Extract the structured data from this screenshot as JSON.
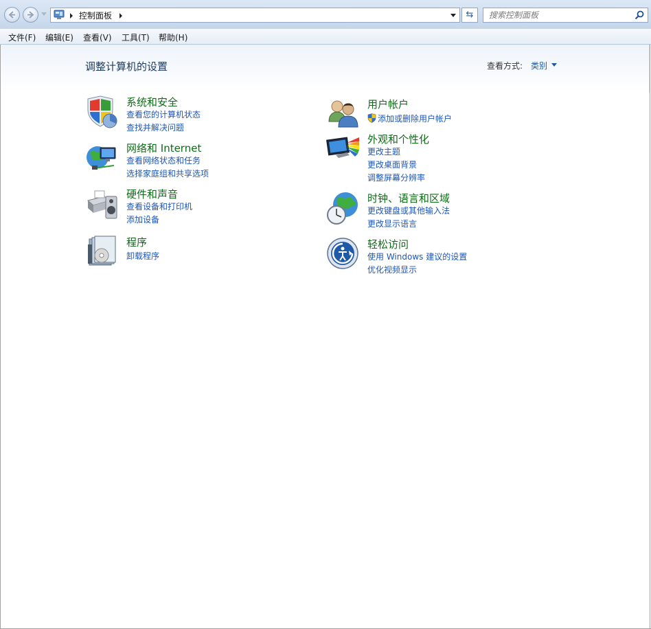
{
  "address_bar": {
    "breadcrumb": "控制面板",
    "search_placeholder": "搜索控制面板"
  },
  "menu": [
    "文件(F)",
    "编辑(E)",
    "查看(V)",
    "工具(T)",
    "帮助(H)"
  ],
  "page_title": "调整计算机的设置",
  "view_by": {
    "label": "查看方式:",
    "value": "类别"
  },
  "categories": [
    {
      "title": "系统和安全",
      "icon": "system-security-icon",
      "links": [
        "查看您的计算机状态",
        "查找并解决问题"
      ]
    },
    {
      "title": "网络和 Internet",
      "icon": "network-internet-icon",
      "links": [
        "查看网络状态和任务",
        "选择家庭组和共享选项"
      ]
    },
    {
      "title": "硬件和声音",
      "icon": "hardware-sound-icon",
      "links": [
        "查看设备和打印机",
        "添加设备"
      ]
    },
    {
      "title": "程序",
      "icon": "programs-icon",
      "links": [
        "卸载程序"
      ]
    },
    {
      "title": "用户帐户",
      "icon": "user-accounts-icon",
      "links": [
        "添加或删除用户帐户"
      ]
    },
    {
      "title": "外观和个性化",
      "icon": "appearance-icon",
      "links": [
        "更改主题",
        "更改桌面背景",
        "调整屏幕分辨率"
      ]
    },
    {
      "title": "时钟、语言和区域",
      "icon": "clock-region-icon",
      "links": [
        "更改键盘或其他输入法",
        "更改显示语言"
      ]
    },
    {
      "title": "轻松访问",
      "icon": "ease-of-access-icon",
      "links": [
        "使用 Windows 建议的设置",
        "优化视频显示"
      ]
    }
  ]
}
